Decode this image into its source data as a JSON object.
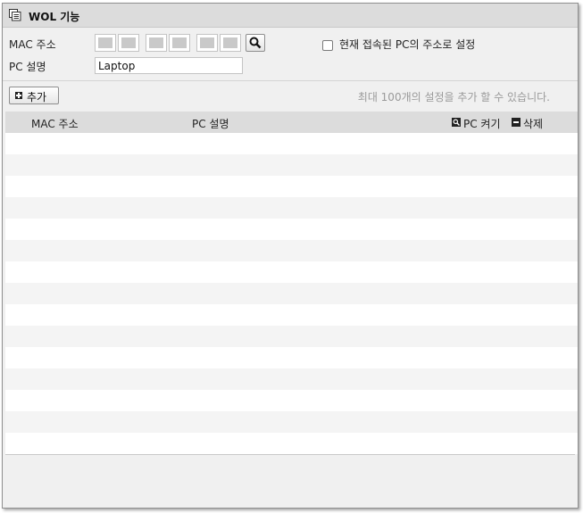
{
  "window": {
    "title": "WOL 기능"
  },
  "form": {
    "mac_label": "MAC 주소",
    "pc_desc_label": "PC 설명",
    "pc_desc_value": "Laptop",
    "use_current_label": "현재 접속된 PC의 주소로 설정",
    "use_current_checked": false
  },
  "toolbar": {
    "add_label": "추가",
    "hint": "최대 100개의 설정을 추가 할 수 있습니다."
  },
  "table": {
    "columns": {
      "mac": "MAC 주소",
      "desc": "PC 설명",
      "wake": "PC 켜기",
      "delete": "삭제"
    },
    "rows": []
  },
  "icons": {
    "title": "window-list-icon",
    "search": "search-icon",
    "add": "plus-icon",
    "wake": "power-on-icon",
    "delete": "minus-icon"
  }
}
